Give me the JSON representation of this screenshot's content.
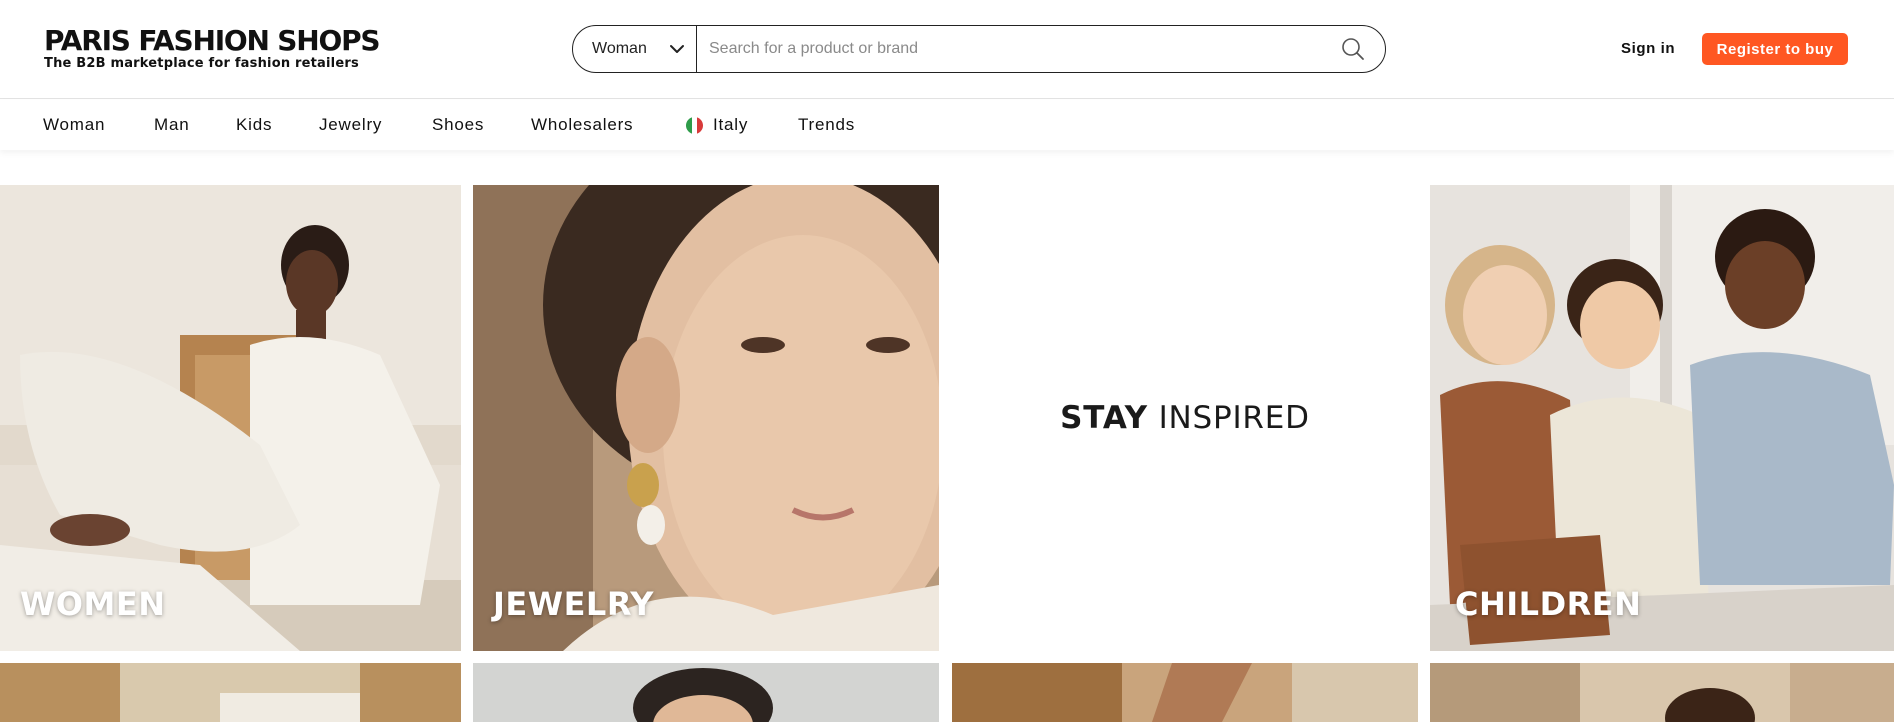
{
  "brand": {
    "title": "PARIS FASHION SHOPS",
    "tagline": "The B2B marketplace for fashion retailers"
  },
  "search": {
    "category": "Woman",
    "placeholder": "Search for a product or brand",
    "icon": "search-icon"
  },
  "account": {
    "signin_label": "Sign in",
    "register_label": "Register to buy"
  },
  "nav": {
    "items": [
      "Woman",
      "Man",
      "Kids",
      "Jewelry",
      "Shoes",
      "Wholesalers",
      "Italy",
      "Trends"
    ]
  },
  "tiles": {
    "women": "WOMEN",
    "jewelry": "JEWELRY",
    "stay_bold": "STAY",
    "stay_rest": "INSPIRED",
    "children": "CHILDREN"
  },
  "colors": {
    "accent": "#ff5722",
    "text": "#111111",
    "border": "#222222"
  }
}
